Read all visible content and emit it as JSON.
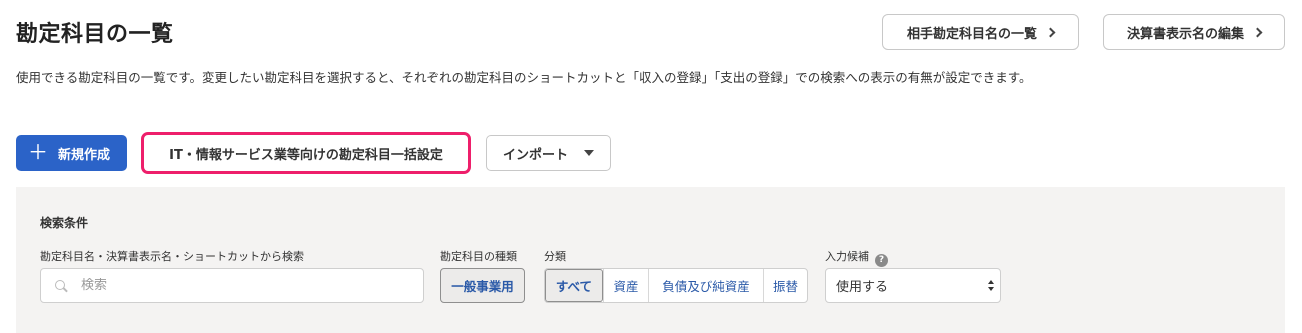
{
  "page": {
    "title": "勘定科目の一覧",
    "description": "使用できる勘定科目の一覧です。変更したい勘定科目を選択すると、それぞれの勘定科目のショートカットと「収入の登録」「支出の登録」での検索への表示の有無が設定できます。"
  },
  "header_buttons": {
    "partner_names": "相手勘定科目名の一覧",
    "report_names": "決算書表示名の編集"
  },
  "toolbar": {
    "new_label": "新規作成",
    "it_setting_label": "IT・情報サービス業等向けの勘定科目一括設定",
    "import_label": "インポート"
  },
  "search": {
    "title": "検索条件",
    "keyword_label": "勘定科目名・決算書表示名・ショートカットから検索",
    "keyword_placeholder": "検索",
    "type_label": "勘定科目の種類",
    "type_value": "一般事業用",
    "category_label": "分類",
    "categories": [
      {
        "label": "すべて",
        "active": true
      },
      {
        "label": "資産",
        "active": false
      },
      {
        "label": "負債及び純資産",
        "active": false
      },
      {
        "label": "振替",
        "active": false
      }
    ],
    "input_label": "入力候補",
    "input_help_glyph": "?",
    "input_value": "使用する"
  },
  "colors": {
    "primary": "#2b63c8",
    "highlight_border": "#ee1f6b",
    "panel_bg": "#f4f3f2",
    "link_text": "#2b5aa8"
  }
}
